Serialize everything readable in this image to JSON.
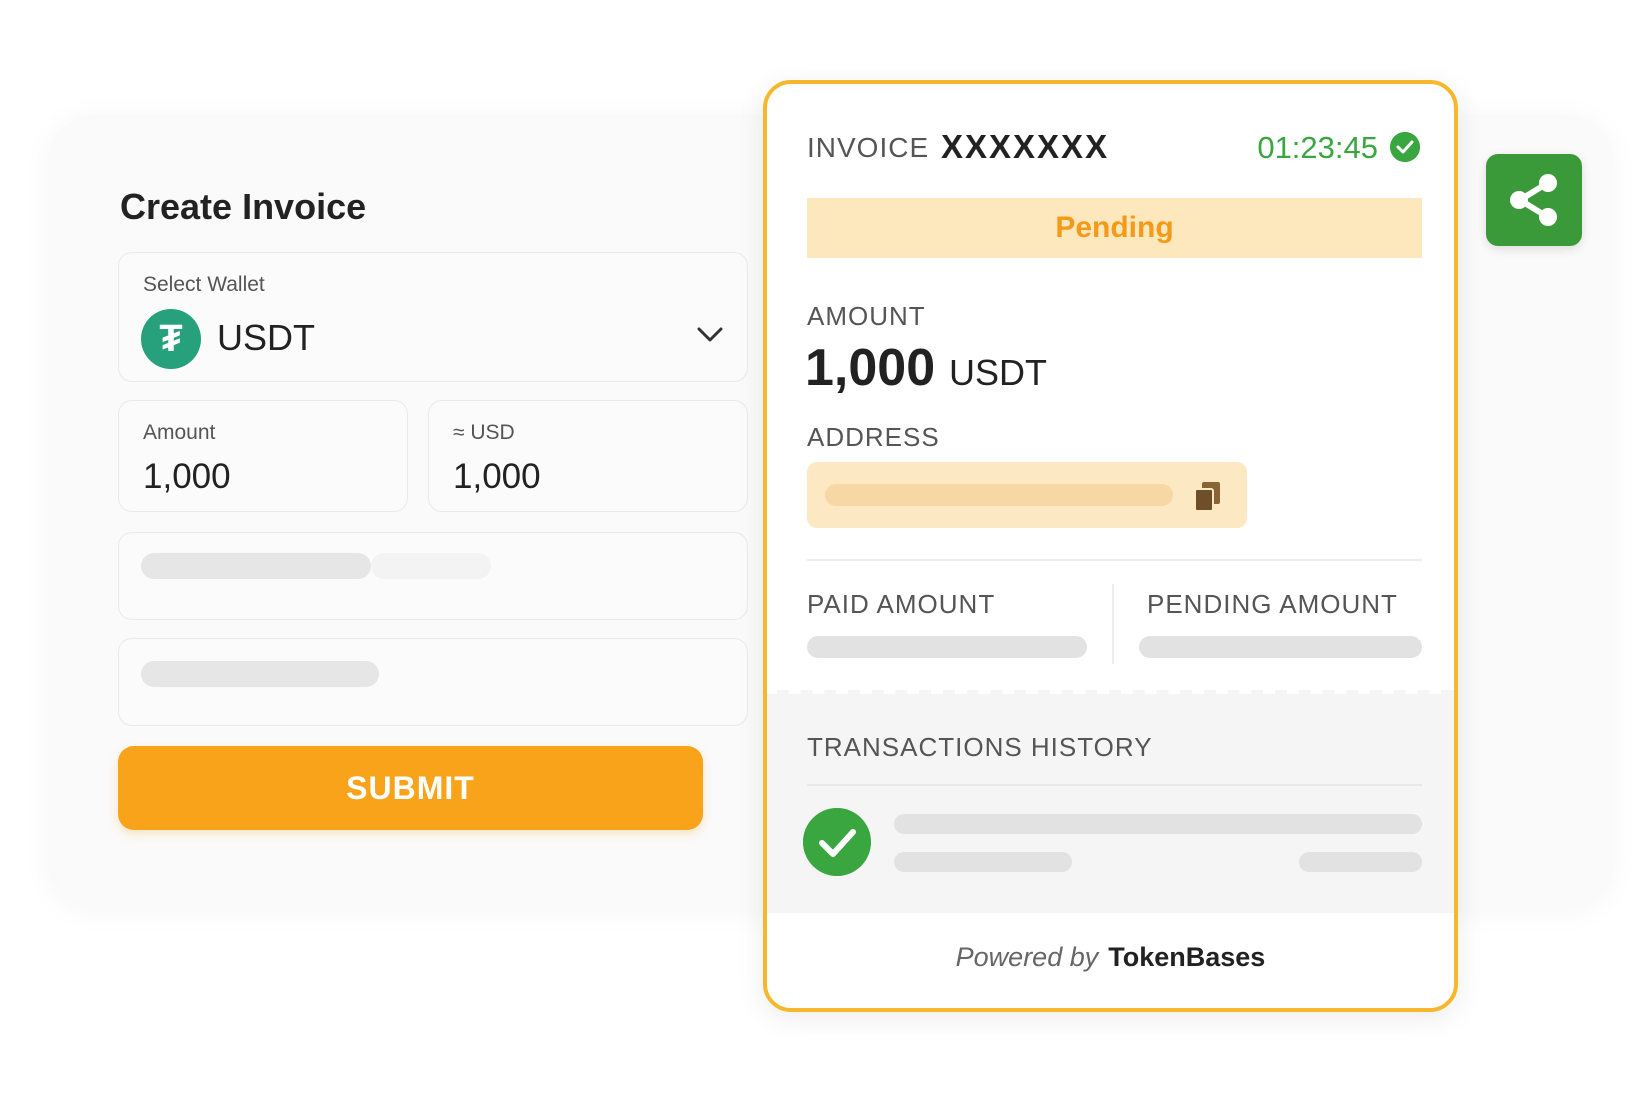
{
  "create_invoice": {
    "title": "Create Invoice",
    "wallet": {
      "label": "Select Wallet",
      "value": "USDT",
      "logo_glyph": "₮"
    },
    "amount": {
      "label": "Amount",
      "value": "1,000"
    },
    "usd": {
      "label": "≈ USD",
      "value": "1,000"
    },
    "submit_label": "SUBMIT"
  },
  "invoice": {
    "title": "INVOICE",
    "number": "XXXXXXX",
    "timer": "01:23:45",
    "status": "Pending",
    "amount_label": "AMOUNT",
    "amount_value": "1,000",
    "amount_currency": "USDT",
    "address_label": "ADDRESS",
    "paid_label": "PAID AMOUNT",
    "pending_label": "PENDING AMOUNT",
    "history_label": "TRANSACTIONS HISTORY",
    "powered_by": "Powered by",
    "brand": "TokenBases"
  },
  "icons": {
    "chevron": "chevron-down-icon",
    "copy": "copy-icon",
    "share": "share-icon",
    "check": "check-circle-icon"
  },
  "colors": {
    "accent_orange": "#f9a31a",
    "card_border": "#f6b72d",
    "pending_bg": "#fde8bd",
    "success_green": "#3aa640",
    "usdt_green": "#26a17b"
  }
}
